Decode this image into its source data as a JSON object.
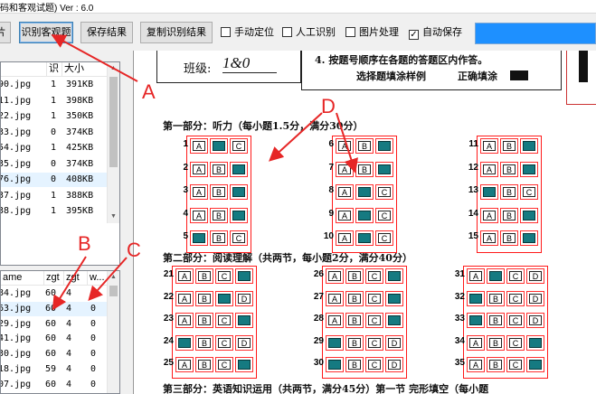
{
  "app": {
    "title": "码和客观试题) Ver : 6.0"
  },
  "toolbar": {
    "cut_left_label": "片",
    "recognize_objective_label": "识别客观题",
    "save_results_label": "保存结果",
    "copy_results_label": "复制识别结果",
    "manual_locate_label": "手动定位",
    "manual_locate_checked": false,
    "manual_recognize_label": "人工识别",
    "manual_recognize_checked": false,
    "image_process_label": "图片处理",
    "image_process_checked": false,
    "auto_save_label": "自动保存",
    "auto_save_checked": true,
    "checkmark": "✓"
  },
  "list1": {
    "headers": [
      "",
      "识",
      "大小"
    ],
    "rows": [
      {
        "name": "90.jpg",
        "rec": "1",
        "size": "391KB"
      },
      {
        "name": "11.jpg",
        "rec": "1",
        "size": "398KB"
      },
      {
        "name": "22.jpg",
        "rec": "1",
        "size": "350KB"
      },
      {
        "name": "33.jpg",
        "rec": "0",
        "size": "374KB"
      },
      {
        "name": "54.jpg",
        "rec": "1",
        "size": "425KB"
      },
      {
        "name": "35.jpg",
        "rec": "0",
        "size": "374KB"
      },
      {
        "name": "76.jpg",
        "rec": "0",
        "size": "408KB"
      },
      {
        "name": "37.jpg",
        "rec": "1",
        "size": "388KB"
      },
      {
        "name": "38.jpg",
        "rec": "1",
        "size": "395KB"
      }
    ]
  },
  "list2": {
    "headers": [
      "ame",
      "zgt",
      "zgt",
      "w..."
    ],
    "rows": [
      {
        "name": "84.jpg",
        "a": "60",
        "b": "4",
        "c": "0"
      },
      {
        "name": "63.jpg",
        "a": "60",
        "b": "4",
        "c": "0"
      },
      {
        "name": "29.jpg",
        "a": "60",
        "b": "4",
        "c": "0"
      },
      {
        "name": "41.jpg",
        "a": "60",
        "b": "4",
        "c": "0"
      },
      {
        "name": "30.jpg",
        "a": "60",
        "b": "4",
        "c": "0"
      },
      {
        "name": "18.jpg",
        "a": "59",
        "b": "4",
        "c": "0"
      },
      {
        "name": "07.jpg",
        "a": "60",
        "b": "4",
        "c": "0"
      }
    ]
  },
  "sheet": {
    "class_label": "班级:",
    "class_value": "1&0",
    "instruction": "4. 按题号顺序在各题的答题区内作答。",
    "instruction_num": "填",
    "sample_label": "选择题填涂样例",
    "correct_label": "正确填涂",
    "part1_title": "第一部分：听力（每小题1.5分，满分30分）",
    "part2_title": "第二部分：阅读理解（共两节，每小题2分，满分40分）",
    "part3_title": "第三部分：英语知识运用（共两节，满分45分）第一节  完形填空（每小题",
    "options_abc": [
      "A",
      "B",
      "C"
    ],
    "options_abcd": [
      "A",
      "B",
      "C",
      "D"
    ],
    "listening_groups": [
      {
        "numbers": [
          "1",
          "2",
          "3",
          "4",
          "5"
        ],
        "answers": [
          "B",
          "C",
          "C",
          "C",
          "A"
        ]
      },
      {
        "numbers": [
          "6",
          "7",
          "8",
          "9",
          "10"
        ],
        "answers": [
          "C",
          "C",
          "B",
          "B",
          "B"
        ]
      },
      {
        "numbers": [
          "11",
          "12",
          "13",
          "14",
          "15"
        ],
        "answers": [
          "C",
          "C",
          "A",
          "C",
          "C"
        ]
      }
    ],
    "reading_groups": [
      {
        "numbers": [
          "21",
          "22",
          "23",
          "24",
          "25"
        ],
        "answers": [
          "D",
          "C",
          "D",
          "A",
          "D"
        ]
      },
      {
        "numbers": [
          "26",
          "27",
          "28",
          "29",
          "30"
        ],
        "answers": [
          "D",
          "D",
          "D",
          "A",
          "A"
        ]
      },
      {
        "numbers": [
          "31",
          "32",
          "33",
          "34",
          "35"
        ],
        "answers": [
          "B",
          "A",
          "A",
          "D",
          "D"
        ]
      }
    ]
  },
  "callouts": {
    "a": "A",
    "b": "B",
    "c": "C",
    "d": "D"
  },
  "colors": {
    "fill": "#22c7c7",
    "region": "#ff1a1a",
    "arrow": "#e62626"
  }
}
